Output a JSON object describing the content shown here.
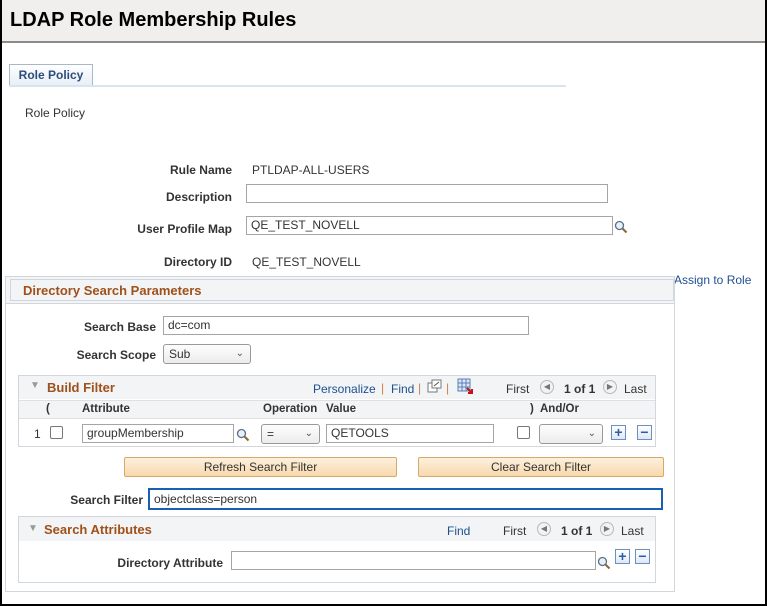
{
  "page": {
    "title": "LDAP Role Membership Rules",
    "tab_label": "Role Policy",
    "subtitle": "Role Policy"
  },
  "fields": {
    "rule_name_label": "Rule Name",
    "rule_name_value": "PTLDAP-ALL-USERS",
    "description_label": "Description",
    "description_value": "",
    "user_profile_map_label": "User Profile Map",
    "user_profile_map_value": "QE_TEST_NOVELL",
    "directory_id_label": "Directory ID",
    "directory_id_value": "QE_TEST_NOVELL"
  },
  "assign_link": "Assign to Role",
  "directory_search": {
    "title": "Directory Search Parameters",
    "search_base_label": "Search Base",
    "search_base_value": "dc=com",
    "search_scope_label": "Search Scope",
    "search_scope_value": "Sub"
  },
  "build_filter": {
    "title": "Build Filter",
    "personalize": "Personalize",
    "find": "Find",
    "separator": "|",
    "first": "First",
    "pager": "1 of 1",
    "last": "Last",
    "columns": [
      "(",
      "Attribute",
      "Operation",
      "Value",
      ")",
      "And/Or"
    ],
    "rows": [
      {
        "num": "1",
        "open_paren": false,
        "attribute": "groupMembership",
        "operation": "=",
        "value": "QETOOLS",
        "close_paren": false,
        "and_or": ""
      }
    ]
  },
  "buttons": {
    "refresh": "Refresh Search Filter",
    "clear": "Clear Search Filter",
    "add": "+",
    "remove": "−"
  },
  "search_filter": {
    "label": "Search Filter",
    "value": "objectclass=person"
  },
  "search_attributes": {
    "title": "Search Attributes",
    "find": "Find",
    "first": "First",
    "pager": "1 of 1",
    "last": "Last",
    "directory_attribute_label": "Directory Attribute",
    "directory_attribute_value": ""
  },
  "icons": {
    "collapse": "▼",
    "prev": "◀",
    "next": "▶",
    "chevron": "⌄"
  }
}
